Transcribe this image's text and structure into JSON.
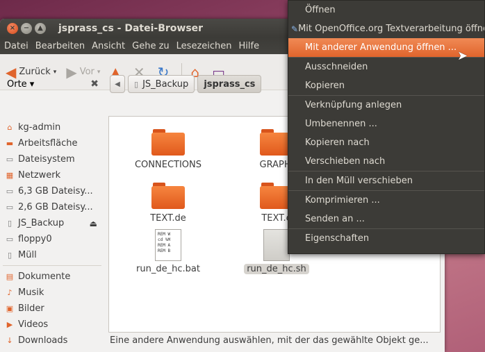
{
  "window": {
    "title": "jsprass_cs - Datei-Browser",
    "controls": {
      "close": "×",
      "minimize": "−",
      "maximize": "▲"
    }
  },
  "menubar": [
    "Datei",
    "Bearbeiten",
    "Ansicht",
    "Gehe zu",
    "Lesezeichen",
    "Hilfe"
  ],
  "toolbar": {
    "back": "Zurück",
    "forward": "Vor",
    "back_icon": "◀",
    "forward_icon": "▶",
    "up_icon": "▲",
    "stop_icon": "✕",
    "reload_icon": "↻",
    "home_icon": "⌂",
    "computer_icon": "▭"
  },
  "sidebar": {
    "header": "Orte ▾",
    "close": "✖",
    "items": [
      {
        "label": "kg-admin",
        "icon": "⌂"
      },
      {
        "label": "Arbeitsfläche",
        "icon": "▬"
      },
      {
        "label": "Dateisystem",
        "icon": "▭"
      },
      {
        "label": "Netzwerk",
        "icon": "▦"
      },
      {
        "label": "6,3 GB Dateisy...",
        "icon": "▭"
      },
      {
        "label": "2,6 GB Dateisy...",
        "icon": "▭"
      },
      {
        "label": "JS_Backup",
        "icon": "▯",
        "eject": "⏏"
      },
      {
        "label": "floppy0",
        "icon": "▭"
      },
      {
        "label": "Müll",
        "icon": "▯"
      }
    ],
    "bookmarks": [
      {
        "label": "Dokumente",
        "icon": "▤"
      },
      {
        "label": "Musik",
        "icon": "♪"
      },
      {
        "label": "Bilder",
        "icon": "▣"
      },
      {
        "label": "Videos",
        "icon": "▶"
      },
      {
        "label": "Downloads",
        "icon": "↓"
      }
    ]
  },
  "breadcrumbs": {
    "arrow": "◀",
    "items": [
      "JS_Backup",
      "jsprass_cs"
    ]
  },
  "files": [
    {
      "name": "CONNECTIONS",
      "type": "folder"
    },
    {
      "name": "GRAPHI",
      "type": "folder"
    },
    {
      "name": "TEXT.de",
      "type": "folder"
    },
    {
      "name": "TEXT.e",
      "type": "folder"
    },
    {
      "name": "run_de_hc.bat",
      "type": "bat",
      "preview": "REM W\ncd %M\nREM A\nREM B"
    },
    {
      "name": "run_de_hc.sh",
      "type": "sh",
      "preview": ""
    }
  ],
  "status": "Eine andere Anwendung auswählen, mit der das gewählte Objekt ge...",
  "context_menu": {
    "items": [
      {
        "label": "Öffnen"
      },
      {
        "label": "Mit OpenOffice.org Textverarbeitung öffnen",
        "icon": "✎"
      },
      {
        "label": "Mit anderer Anwendung öffnen ...",
        "highlight": true
      },
      {
        "label": "Ausschneiden"
      },
      {
        "label": "Kopieren"
      },
      {
        "label": "Verknüpfung anlegen"
      },
      {
        "label": "Umbenennen ..."
      },
      {
        "label": "Kopieren nach"
      },
      {
        "label": "Verschieben nach"
      },
      {
        "label": "In den Müll verschieben"
      },
      {
        "label": "Komprimieren ..."
      },
      {
        "label": "Senden an ..."
      },
      {
        "label": "Eigenschaften"
      }
    ]
  },
  "colors": {
    "accent": "#e0642c",
    "folder": "#f6853f",
    "dark_chrome": "#3c3b37"
  }
}
